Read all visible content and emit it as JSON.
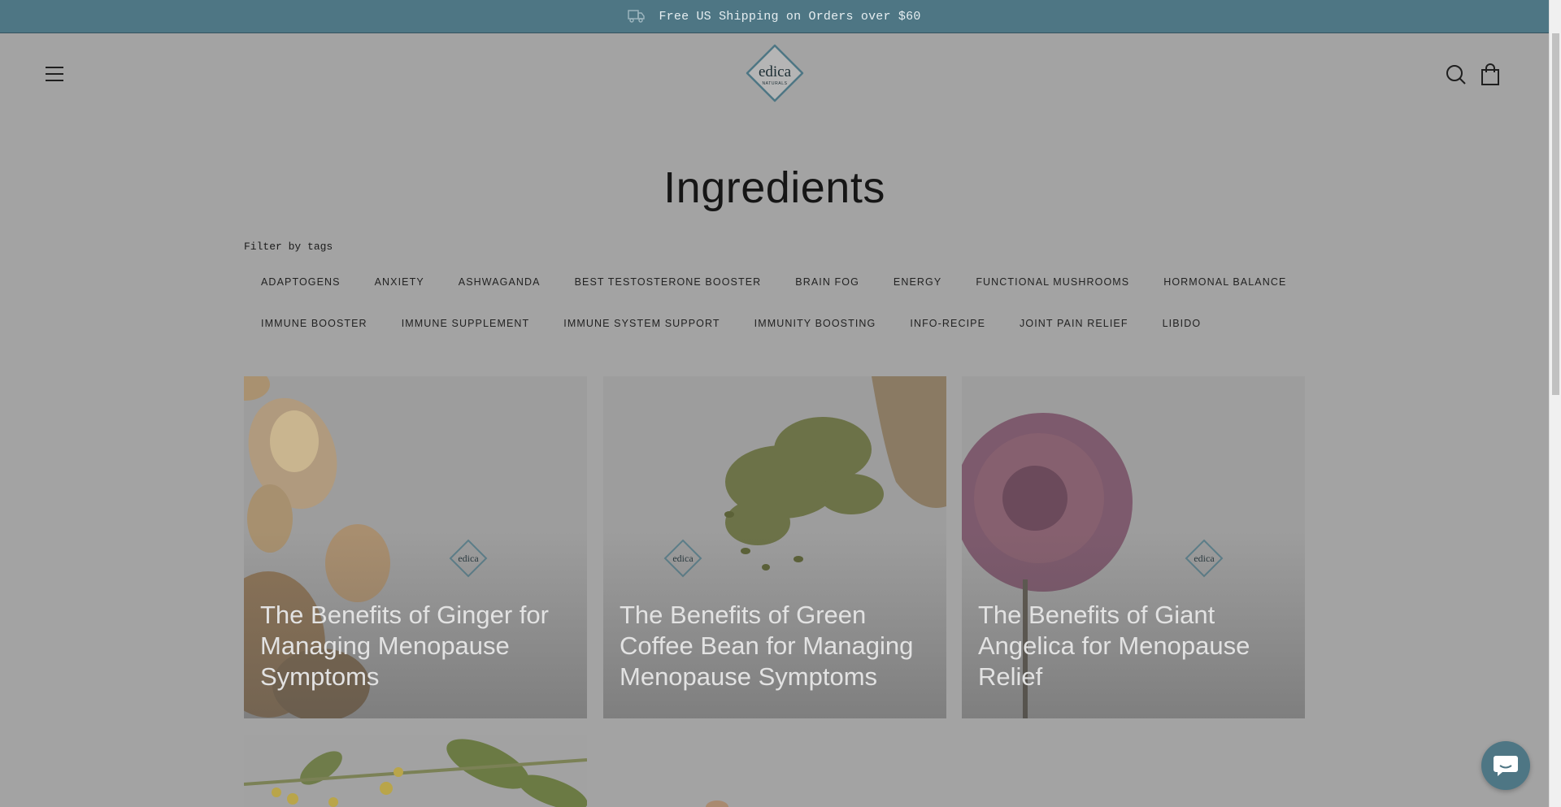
{
  "announcement": {
    "text": "Free US Shipping on Orders over $60",
    "icon": "truck-icon"
  },
  "header": {
    "logo_text": "edica",
    "logo_subtext": "NATURALS",
    "menu_icon": "hamburger-menu-icon",
    "search_icon": "search-icon",
    "cart_icon": "shopping-bag-icon"
  },
  "page": {
    "title": "Ingredients",
    "filter_label": "Filter by tags"
  },
  "tags": {
    "row1": [
      "ADAPTOGENS",
      "ANXIETY",
      "ASHWAGANDA",
      "BEST TESTOSTERONE BOOSTER",
      "BRAIN FOG",
      "ENERGY",
      "FUNCTIONAL MUSHROOMS",
      "HORMONAL BALANCE"
    ],
    "row2": [
      "IMMUNE BOOSTER",
      "IMMUNE SUPPLEMENT",
      "IMMUNE SYSTEM SUPPORT",
      "IMMUNITY BOOSTING",
      "INFO-RECIPE",
      "JOINT PAIN RELIEF",
      "LIBIDO"
    ]
  },
  "articles": [
    {
      "title": "The Benefits of Ginger for Managing Menopause Symptoms",
      "image": "ginger"
    },
    {
      "title": "The Benefits of Green Coffee Bean for Managing Menopause Symptoms",
      "image": "green-coffee-beans"
    },
    {
      "title": "The Benefits of Giant Angelica for Menopause Relief",
      "image": "giant-angelica-flower"
    },
    {
      "title": "",
      "image": "yellow-flowers"
    },
    {
      "title": "",
      "image": "unknown"
    }
  ],
  "chat": {
    "icon": "chat-icon"
  },
  "colors": {
    "accent": "#4e7684",
    "overlay": "#a3a3a3"
  }
}
